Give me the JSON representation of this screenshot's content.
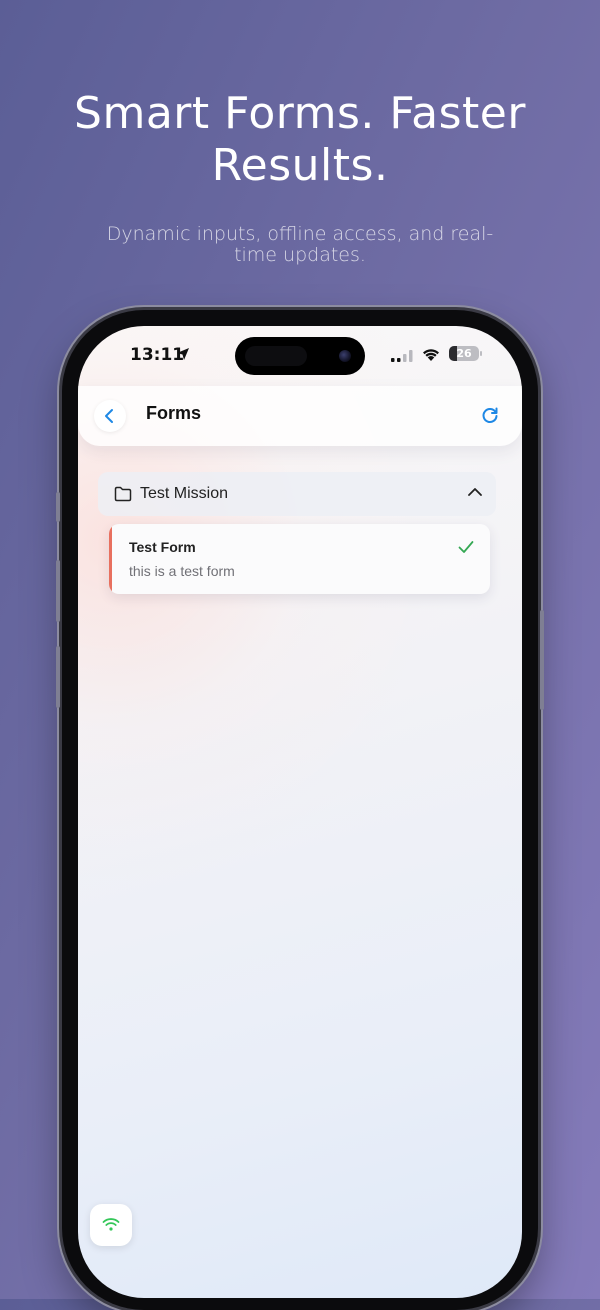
{
  "promo": {
    "headline": "Smart Forms. Faster Results.",
    "subheadline": "Dynamic inputs, offline access, and real-time updates."
  },
  "status_bar": {
    "time": "13:11",
    "battery": 26,
    "icons": [
      "location-arrow-icon",
      "cellular-signal-icon",
      "wifi-icon",
      "battery-icon"
    ]
  },
  "header": {
    "title": "Forms",
    "back_icon": "chevron-left-icon",
    "refresh_icon": "refresh-icon"
  },
  "missions": [
    {
      "name": "Test Mission",
      "icon": "folder-icon",
      "expanded": true,
      "forms": [
        {
          "title": "Test Form",
          "description": "this is a test form",
          "status": "completed"
        }
      ]
    }
  ],
  "connectivity": {
    "icon": "wifi-icon",
    "status": "online"
  },
  "colors": {
    "accent": "#1e88e5",
    "form_accent": "#e8705f",
    "success": "#34a853"
  }
}
